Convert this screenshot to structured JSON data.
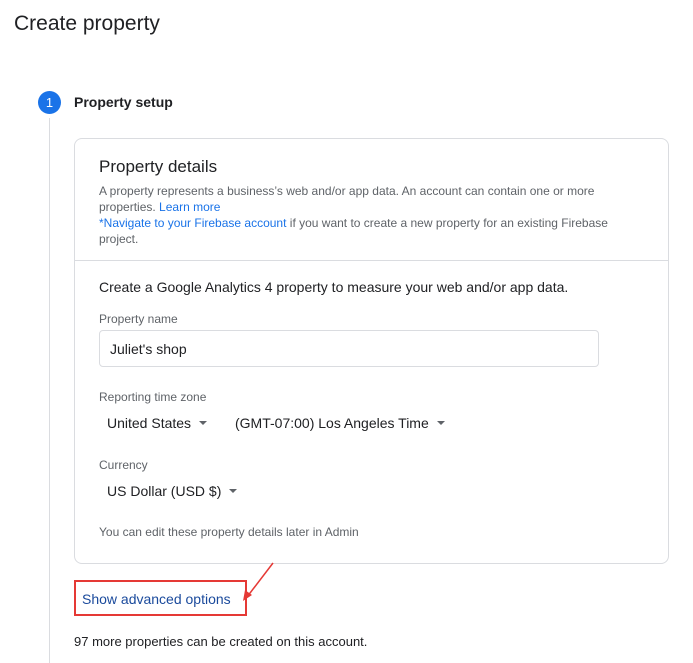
{
  "page": {
    "title": "Create property"
  },
  "step": {
    "number": "1",
    "title": "Property setup"
  },
  "details": {
    "title": "Property details",
    "desc_line": "A property represents a business’s web and/or app data. An account can contain one or more properties.",
    "learn_more": "Learn more",
    "firebase_link": "*Navigate to your Firebase account",
    "firebase_rest": " if you want to create a new property for an existing Firebase project."
  },
  "form": {
    "intro": "Create a Google Analytics 4 property to measure your web and/or app data.",
    "property_name_label": "Property name",
    "property_name_value": "Juliet's shop",
    "timezone_label": "Reporting time zone",
    "country_value": "United States",
    "timezone_value": "(GMT-07:00) Los Angeles Time",
    "currency_label": "Currency",
    "currency_value": "US Dollar (USD $)",
    "note": "You can edit these property details later in Admin"
  },
  "advanced": {
    "label": "Show advanced options"
  },
  "footer": {
    "more_properties": "97 more properties can be created on this account."
  },
  "colors": {
    "accent": "#1a73e8",
    "annotation": "#e53935"
  }
}
